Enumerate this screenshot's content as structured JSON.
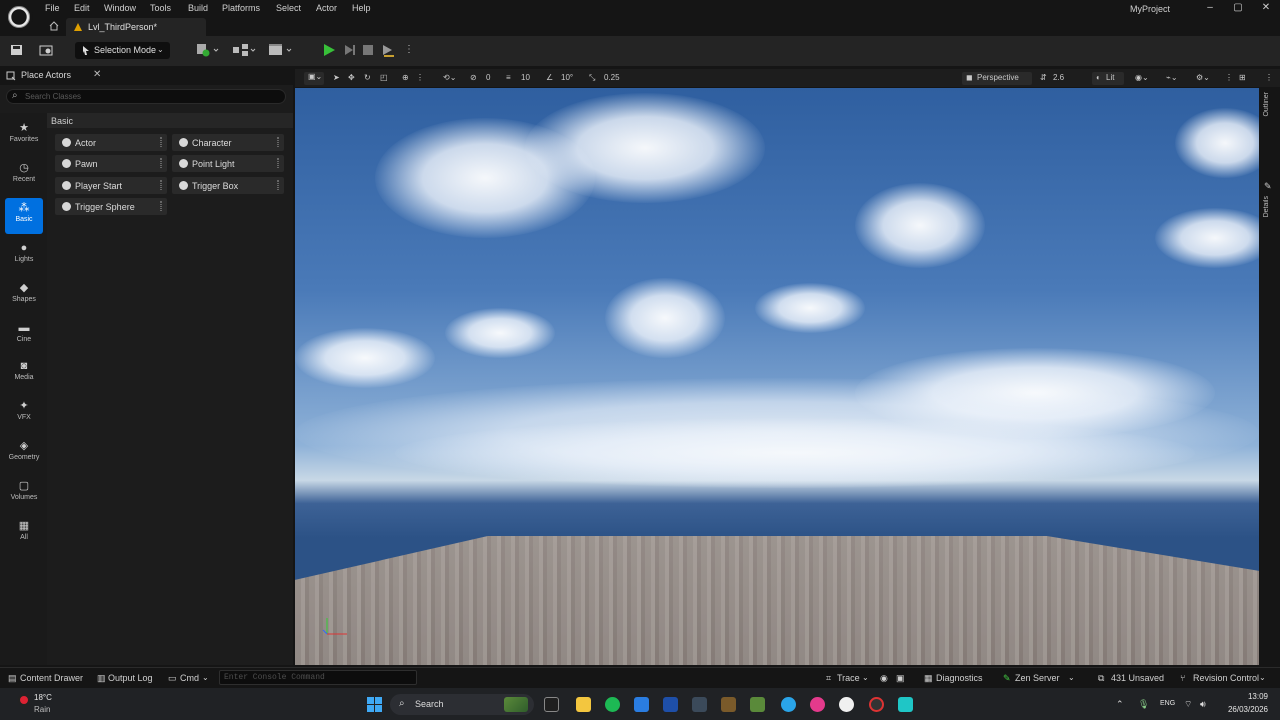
{
  "menu": [
    "File",
    "Edit",
    "Window",
    "Tools",
    "Build",
    "Platforms",
    "Select",
    "Actor",
    "Help"
  ],
  "project_name": "MyProject",
  "level_tab": "Lvl_ThirdPerson*",
  "toolbar": {
    "selection_mode": "Selection Mode"
  },
  "place_actors": {
    "title": "Place Actors",
    "search_placeholder": "Search Classes",
    "section": "Basic",
    "categories": [
      "Favorites",
      "Recent",
      "Basic",
      "Lights",
      "Shapes",
      "Cine",
      "Media",
      "VFX",
      "Geometry",
      "Volumes",
      "All"
    ],
    "active_category": "Basic",
    "actors": [
      "Actor",
      "Character",
      "Pawn",
      "Point Light",
      "Player Start",
      "Trigger Box",
      "Trigger Sphere"
    ]
  },
  "viewport": {
    "grid_value": "10",
    "rotation_value": "10°",
    "scale_value": "0.25",
    "camera_speed": "2.6",
    "view_mode": "Perspective",
    "lighting": "Lit",
    "count_0": "0",
    "count_1": "0"
  },
  "side_tabs": {
    "outliner": "Outliner",
    "details": "Details"
  },
  "statusbar": {
    "content_drawer": "Content Drawer",
    "output_log": "Output Log",
    "cmd": "Cmd",
    "console_placeholder": "Enter Console Command",
    "trace": "Trace",
    "diagnostics": "Diagnostics",
    "zen_server": "Zen Server",
    "unsaved": "431 Unsaved",
    "revision_control": "Revision Control"
  },
  "taskbar": {
    "weather_temp": "18°C",
    "weather_desc": "Rain",
    "search": "Search",
    "lang": "ENG",
    "time": "13:09",
    "date": "26/03/2026"
  },
  "colors": {
    "accent": "#0070e0",
    "play": "#38c039",
    "level_icon": "#e0a000"
  }
}
